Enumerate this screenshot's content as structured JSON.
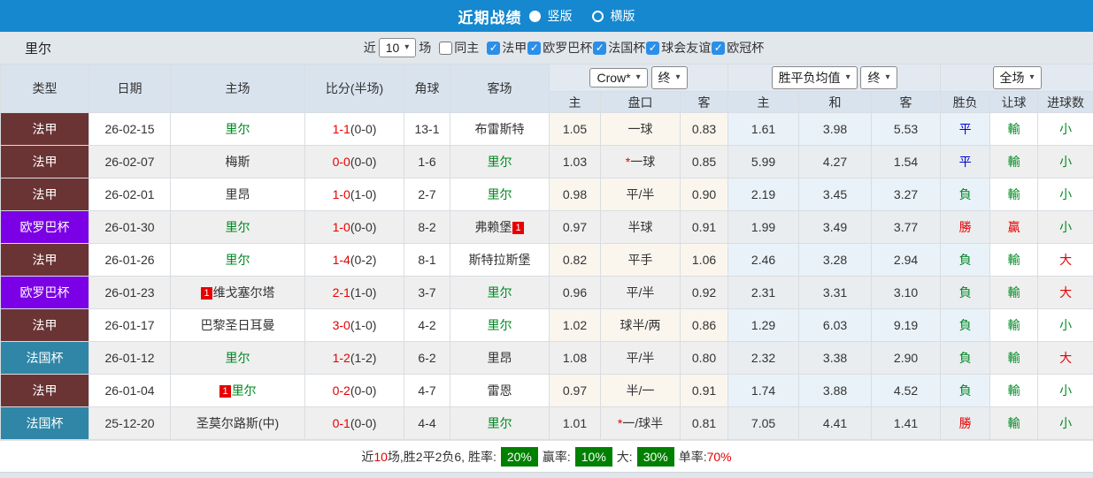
{
  "topbar": {
    "title": "近期战绩",
    "radio_vertical": "竖版",
    "radio_horizontal": "横版"
  },
  "filter": {
    "team": "里尔",
    "recent_label": "近",
    "recent_value": "10",
    "matches_label": "场",
    "same_home_label": "同主",
    "same_home_checked": false,
    "leagues": [
      {
        "label": "法甲",
        "checked": true
      },
      {
        "label": "欧罗巴杯",
        "checked": true
      },
      {
        "label": "法国杯",
        "checked": true
      },
      {
        "label": "球会友谊",
        "checked": true
      },
      {
        "label": "欧冠杯",
        "checked": true
      }
    ]
  },
  "table": {
    "columns": [
      "类型",
      "日期",
      "主场",
      "比分(半场)",
      "角球",
      "客场"
    ],
    "selects": {
      "odds_source": "Crow*",
      "odds_time1": "终",
      "avg_label": "胜平负均值",
      "odds_time2": "终",
      "scope": "全场"
    },
    "subcolumns": [
      "主",
      "盘口",
      "客",
      "主",
      "和",
      "客",
      "胜负",
      "让球",
      "进球数"
    ],
    "rows": [
      {
        "type": "法甲",
        "type_key": "ligue1",
        "date": "26-02-15",
        "home": {
          "name": "里尔",
          "green": true
        },
        "score": "1-1",
        "half": "(0-0)",
        "corner": "13-1",
        "away": {
          "name": "布雷斯特"
        },
        "odds": [
          "1.05",
          "一球",
          "0.83"
        ],
        "star": false,
        "avg": [
          "1.61",
          "3.98",
          "5.53"
        ],
        "result": {
          "t": "平",
          "c": "blue"
        },
        "let": {
          "t": "輸",
          "c": "green"
        },
        "goal": {
          "t": "小",
          "c": "green"
        }
      },
      {
        "type": "法甲",
        "type_key": "ligue1",
        "date": "26-02-07",
        "home": {
          "name": "梅斯"
        },
        "score": "0-0",
        "half": "(0-0)",
        "corner": "1-6",
        "away": {
          "name": "里尔",
          "green": true
        },
        "odds": [
          "1.03",
          "一球",
          "0.85"
        ],
        "star": true,
        "avg": [
          "5.99",
          "4.27",
          "1.54"
        ],
        "result": {
          "t": "平",
          "c": "blue"
        },
        "let": {
          "t": "輸",
          "c": "green"
        },
        "goal": {
          "t": "小",
          "c": "green"
        }
      },
      {
        "type": "法甲",
        "type_key": "ligue1",
        "date": "26-02-01",
        "home": {
          "name": "里昂"
        },
        "score": "1-0",
        "half": "(1-0)",
        "corner": "2-7",
        "away": {
          "name": "里尔",
          "green": true
        },
        "odds": [
          "0.98",
          "平/半",
          "0.90"
        ],
        "star": false,
        "avg": [
          "2.19",
          "3.45",
          "3.27"
        ],
        "result": {
          "t": "負",
          "c": "green"
        },
        "let": {
          "t": "輸",
          "c": "green"
        },
        "goal": {
          "t": "小",
          "c": "green"
        }
      },
      {
        "type": "欧罗巴杯",
        "type_key": "europa",
        "date": "26-01-30",
        "home": {
          "name": "里尔",
          "green": true
        },
        "score": "1-0",
        "half": "(0-0)",
        "corner": "8-2",
        "away": {
          "name": "弗赖堡",
          "badge": "1"
        },
        "odds": [
          "0.97",
          "半球",
          "0.91"
        ],
        "star": false,
        "avg": [
          "1.99",
          "3.49",
          "3.77"
        ],
        "result": {
          "t": "勝",
          "c": "red"
        },
        "let": {
          "t": "贏",
          "c": "red"
        },
        "goal": {
          "t": "小",
          "c": "green"
        }
      },
      {
        "type": "法甲",
        "type_key": "ligue1",
        "date": "26-01-26",
        "home": {
          "name": "里尔",
          "green": true
        },
        "score": "1-4",
        "half": "(0-2)",
        "corner": "8-1",
        "away": {
          "name": "斯特拉斯堡"
        },
        "odds": [
          "0.82",
          "平手",
          "1.06"
        ],
        "star": false,
        "avg": [
          "2.46",
          "3.28",
          "2.94"
        ],
        "result": {
          "t": "負",
          "c": "green"
        },
        "let": {
          "t": "輸",
          "c": "green"
        },
        "goal": {
          "t": "大",
          "c": "red"
        }
      },
      {
        "type": "欧罗巴杯",
        "type_key": "europa",
        "date": "26-01-23",
        "home": {
          "name": "维戈塞尔塔",
          "badge": "1"
        },
        "score": "2-1",
        "half": "(1-0)",
        "corner": "3-7",
        "away": {
          "name": "里尔",
          "green": true
        },
        "odds": [
          "0.96",
          "平/半",
          "0.92"
        ],
        "star": false,
        "avg": [
          "2.31",
          "3.31",
          "3.10"
        ],
        "result": {
          "t": "負",
          "c": "green"
        },
        "let": {
          "t": "輸",
          "c": "green"
        },
        "goal": {
          "t": "大",
          "c": "red"
        }
      },
      {
        "type": "法甲",
        "type_key": "ligue1",
        "date": "26-01-17",
        "home": {
          "name": "巴黎圣日耳曼"
        },
        "score": "3-0",
        "half": "(1-0)",
        "corner": "4-2",
        "away": {
          "name": "里尔",
          "green": true
        },
        "odds": [
          "1.02",
          "球半/两",
          "0.86"
        ],
        "star": false,
        "avg": [
          "1.29",
          "6.03",
          "9.19"
        ],
        "result": {
          "t": "負",
          "c": "green"
        },
        "let": {
          "t": "輸",
          "c": "green"
        },
        "goal": {
          "t": "小",
          "c": "green"
        }
      },
      {
        "type": "法国杯",
        "type_key": "coupe",
        "date": "26-01-12",
        "home": {
          "name": "里尔",
          "green": true
        },
        "score": "1-2",
        "half": "(1-2)",
        "corner": "6-2",
        "away": {
          "name": "里昂"
        },
        "odds": [
          "1.08",
          "平/半",
          "0.80"
        ],
        "star": false,
        "avg": [
          "2.32",
          "3.38",
          "2.90"
        ],
        "result": {
          "t": "負",
          "c": "green"
        },
        "let": {
          "t": "輸",
          "c": "green"
        },
        "goal": {
          "t": "大",
          "c": "red"
        }
      },
      {
        "type": "法甲",
        "type_key": "ligue1",
        "date": "26-01-04",
        "home": {
          "name": "里尔",
          "green": true,
          "badge": "1"
        },
        "score": "0-2",
        "half": "(0-0)",
        "corner": "4-7",
        "away": {
          "name": "雷恩"
        },
        "odds": [
          "0.97",
          "半/一",
          "0.91"
        ],
        "star": false,
        "avg": [
          "1.74",
          "3.88",
          "4.52"
        ],
        "result": {
          "t": "負",
          "c": "green"
        },
        "let": {
          "t": "輸",
          "c": "green"
        },
        "goal": {
          "t": "小",
          "c": "green"
        }
      },
      {
        "type": "法国杯",
        "type_key": "coupe",
        "date": "25-12-20",
        "home": {
          "name": "圣莫尔路斯(中)"
        },
        "score": "0-1",
        "half": "(0-0)",
        "corner": "4-4",
        "away": {
          "name": "里尔",
          "green": true
        },
        "odds": [
          "1.01",
          "一/球半",
          "0.81"
        ],
        "star": true,
        "avg": [
          "7.05",
          "4.41",
          "1.41"
        ],
        "result": {
          "t": "勝",
          "c": "red"
        },
        "let": {
          "t": "輸",
          "c": "green"
        },
        "goal": {
          "t": "小",
          "c": "green"
        }
      }
    ]
  },
  "summary": {
    "parts": [
      {
        "t": "近"
      },
      {
        "t": "10",
        "c": "red"
      },
      {
        "t": "场,胜2平2负6, 胜率:"
      },
      {
        "t": "20%",
        "badge": true
      },
      {
        "t": "赢率:"
      },
      {
        "t": "10%",
        "badge": true
      },
      {
        "t": "大:"
      },
      {
        "t": "30%",
        "badge": true
      },
      {
        "t": "单率:"
      },
      {
        "t": "70%",
        "c": "red"
      }
    ]
  },
  "colors": {
    "accent_blue": "#1588d0",
    "type_ligue1": "#6b3434",
    "type_europa": "#7b00e6",
    "type_coupe": "#2f86a6",
    "green": "#008822",
    "red": "#e60000",
    "blue": "#0000cc",
    "badge_green": "#008000",
    "checkbox_blue": "#2b8fe8"
  }
}
